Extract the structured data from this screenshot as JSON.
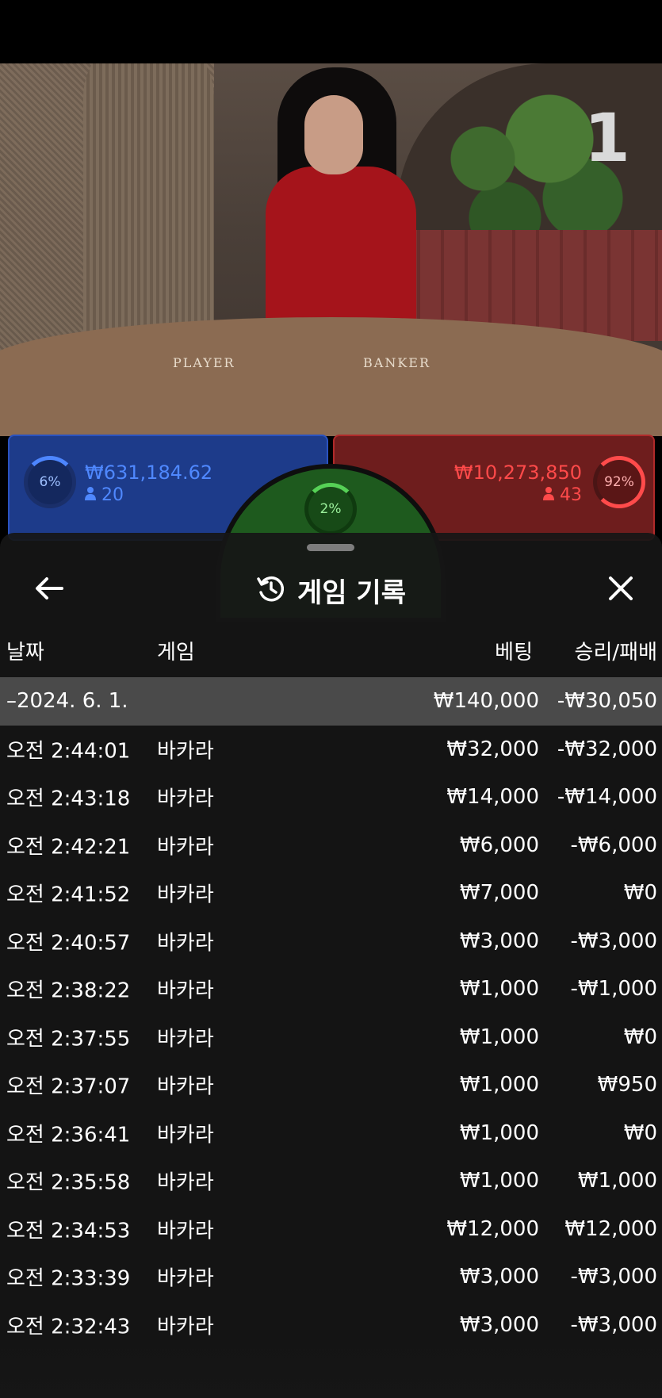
{
  "video": {
    "round_number": "1",
    "table_labels": [
      "PLAYER",
      "BANKER"
    ]
  },
  "bets": {
    "player": {
      "percent": "6%",
      "amount": "₩631,184.62",
      "players": "20"
    },
    "banker": {
      "amount": "₩10,273,850",
      "players": "43",
      "percent": "92%"
    },
    "tie": {
      "percent": "2%"
    }
  },
  "history": {
    "title": "게임 기록",
    "back_icon": "arrow-left-icon",
    "history_icon": "history-clock-icon",
    "close_icon": "close-icon",
    "columns": {
      "date": "날짜",
      "game": "게임",
      "bet": "베팅",
      "result": "승리/패배"
    },
    "summary": {
      "date": "–2024. 6. 1.",
      "bet": "₩140,000",
      "result": "-₩30,050"
    },
    "rows": [
      {
        "time": "오전 2:44:01",
        "game": "바카라",
        "bet": "₩32,000",
        "result": "-₩32,000"
      },
      {
        "time": "오전 2:43:18",
        "game": "바카라",
        "bet": "₩14,000",
        "result": "-₩14,000"
      },
      {
        "time": "오전 2:42:21",
        "game": "바카라",
        "bet": "₩6,000",
        "result": "-₩6,000"
      },
      {
        "time": "오전 2:41:52",
        "game": "바카라",
        "bet": "₩7,000",
        "result": "₩0"
      },
      {
        "time": "오전 2:40:57",
        "game": "바카라",
        "bet": "₩3,000",
        "result": "-₩3,000"
      },
      {
        "time": "오전 2:38:22",
        "game": "바카라",
        "bet": "₩1,000",
        "result": "-₩1,000"
      },
      {
        "time": "오전 2:37:55",
        "game": "바카라",
        "bet": "₩1,000",
        "result": "₩0"
      },
      {
        "time": "오전 2:37:07",
        "game": "바카라",
        "bet": "₩1,000",
        "result": "₩950"
      },
      {
        "time": "오전 2:36:41",
        "game": "바카라",
        "bet": "₩1,000",
        "result": "₩0"
      },
      {
        "time": "오전 2:35:58",
        "game": "바카라",
        "bet": "₩1,000",
        "result": "₩1,000"
      },
      {
        "time": "오전 2:34:53",
        "game": "바카라",
        "bet": "₩12,000",
        "result": "₩12,000"
      },
      {
        "time": "오전 2:33:39",
        "game": "바카라",
        "bet": "₩3,000",
        "result": "-₩3,000"
      },
      {
        "time": "오전 2:32:43",
        "game": "바카라",
        "bet": "₩3,000",
        "result": "-₩3,000"
      }
    ]
  },
  "colors": {
    "player": "#2a52c0",
    "banker": "#b02a2a",
    "tie": "#1e5a1e",
    "sheet": "#161616"
  }
}
